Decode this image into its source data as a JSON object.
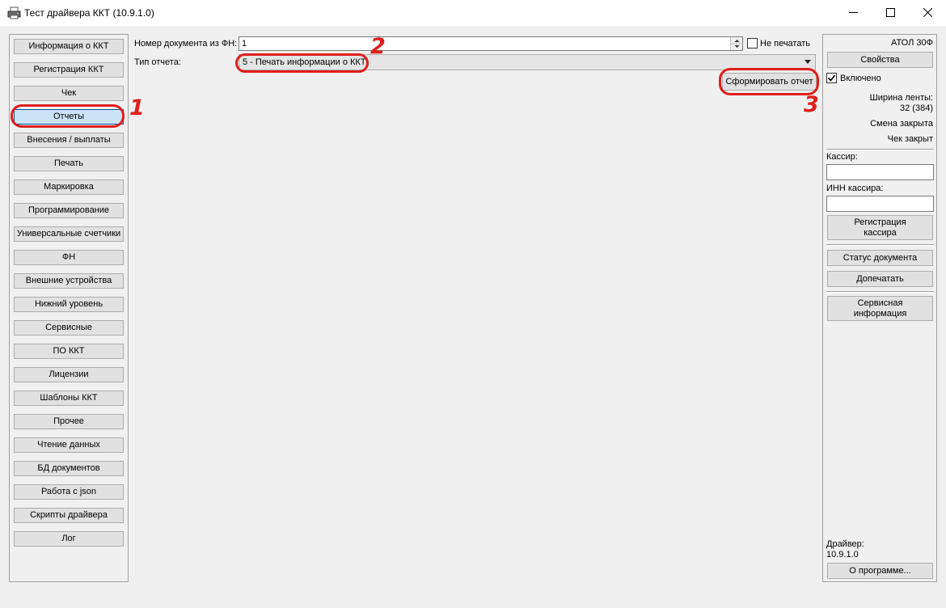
{
  "window": {
    "title": "Тест драйвера ККТ (10.9.1.0)",
    "icon": "printer-icon"
  },
  "nav": {
    "items": [
      {
        "label": "Информация о ККТ"
      },
      {
        "label": "Регистрация ККТ"
      },
      {
        "label": "Чек"
      },
      {
        "label": "Отчеты"
      },
      {
        "label": "Внесения / выплаты"
      },
      {
        "label": "Печать"
      },
      {
        "label": "Маркировка"
      },
      {
        "label": "Программирование"
      },
      {
        "label": "Универсальные счетчики"
      },
      {
        "label": "ФН"
      },
      {
        "label": "Внешние устройства"
      },
      {
        "label": "Нижний уровень"
      },
      {
        "label": "Сервисные"
      },
      {
        "label": "ПО ККТ"
      },
      {
        "label": "Лицензии"
      },
      {
        "label": "Шаблоны ККТ"
      },
      {
        "label": "Прочее"
      },
      {
        "label": "Чтение данных"
      },
      {
        "label": "БД документов"
      },
      {
        "label": "Работа с json"
      },
      {
        "label": "Скрипты драйвера"
      },
      {
        "label": "Лог"
      }
    ],
    "active": "Отчеты"
  },
  "main": {
    "doc_number_label": "Номер документа из ФН:",
    "doc_number_value": "1",
    "no_print_label": "Не печатать",
    "no_print_checked": false,
    "report_type_label": "Тип отчета:",
    "report_type_value": "5 - Печать информации о ККТ",
    "generate_button": "Сформировать отчет"
  },
  "right": {
    "device_name": "АТОЛ 30Ф",
    "properties_button": "Свойства",
    "enabled_label": "Включено",
    "enabled_checked": true,
    "tape_width_label": "Ширина ленты:",
    "tape_width_value": "32 (384)",
    "shift_status": "Смена закрыта",
    "receipt_status": "Чек закрыт",
    "cashier_label": "Кассир:",
    "cashier_value": "",
    "cashier_inn_label": "ИНН кассира:",
    "cashier_inn_value": "",
    "register_cashier_button_line1": "Регистрация",
    "register_cashier_button_line2": "кассира",
    "doc_status_button": "Статус документа",
    "reprint_button": "Допечатать",
    "service_info_button_line1": "Сервисная",
    "service_info_button_line2": "информация",
    "driver_label": "Драйвер:",
    "driver_version": "10.9.1.0",
    "about_button": "О программе..."
  },
  "annotations": {
    "color": "#e01e1e",
    "step1": "1",
    "step2": "2",
    "step3": "3"
  }
}
